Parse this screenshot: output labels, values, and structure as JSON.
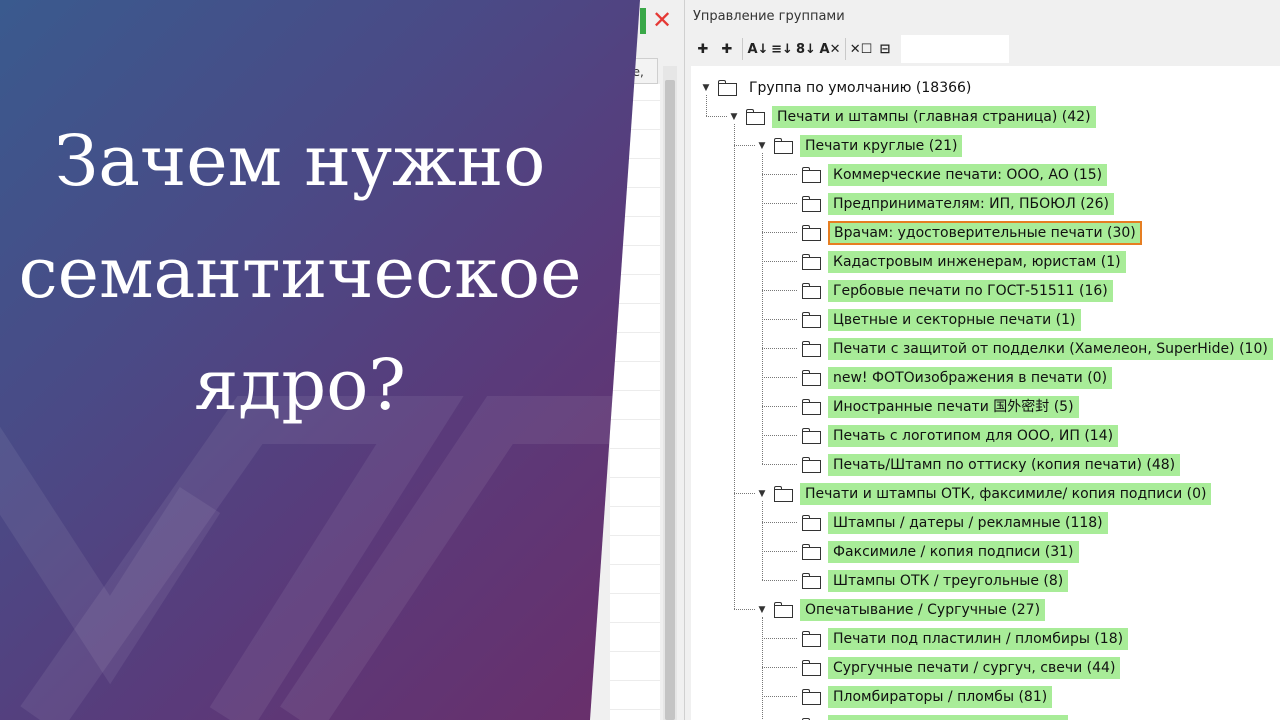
{
  "headline": [
    "Зачем нужно",
    "семантическое",
    "ядро?"
  ],
  "window": {
    "title": "Управление группами",
    "search_value": ""
  },
  "left_pane": {
    "header_fragment": "ре,"
  },
  "toolbar": [
    {
      "name": "add-group-icon",
      "glyph": "✚"
    },
    {
      "name": "add-subgroup-icon",
      "glyph": "✚"
    },
    {
      "name": "sort-az-icon",
      "glyph": "A↓"
    },
    {
      "name": "sort-color-icon",
      "glyph": "≡↓"
    },
    {
      "name": "sort-num-icon",
      "glyph": "8↓"
    },
    {
      "name": "clear-sort-icon",
      "glyph": "A✕"
    },
    {
      "name": "mark-icon",
      "glyph": "✕☐"
    },
    {
      "name": "tree-icon",
      "glyph": "⊟"
    }
  ],
  "tree": [
    {
      "label": "Группа по умолчанию (18366)",
      "level": 0,
      "expanded": true,
      "highlight": false
    },
    {
      "label": "Печати и штампы (главная страница) (42)",
      "level": 1,
      "expanded": true,
      "highlight": true
    },
    {
      "label": "Печати круглые (21)",
      "level": 2,
      "expanded": true,
      "highlight": true
    },
    {
      "label": "Коммерческие печати: ООО, АО (15)",
      "level": 3,
      "highlight": true
    },
    {
      "label": "Предпринимателям: ИП, ПБОЮЛ (26)",
      "level": 3,
      "highlight": true
    },
    {
      "label": "Врачам: удостоверительные печати (30)",
      "level": 3,
      "highlight": true,
      "selected": true
    },
    {
      "label": "Кадастровым инженерам, юристам (1)",
      "level": 3,
      "highlight": true
    },
    {
      "label": "Гербовые печати по ГОСТ-51511 (16)",
      "level": 3,
      "highlight": true
    },
    {
      "label": "Цветные и секторные печати (1)",
      "level": 3,
      "highlight": true
    },
    {
      "label": "Печати с защитой от подделки (Хамелеон, SuperHide) (10)",
      "level": 3,
      "highlight": true
    },
    {
      "label": "new! ФОТОизображения в печати (0)",
      "level": 3,
      "highlight": true
    },
    {
      "label": "Иностранные печати 国外密封 (5)",
      "level": 3,
      "highlight": true
    },
    {
      "label": "Печать с логотипом для ООО, ИП (14)",
      "level": 3,
      "highlight": true
    },
    {
      "label": "Печать/Штамп по оттиску (копия печати) (48)",
      "level": 3,
      "highlight": true
    },
    {
      "label": "Печати и штампы ОТК, факсимиле/ копия подписи (0)",
      "level": 2,
      "expanded": true,
      "highlight": true
    },
    {
      "label": "Штампы / датеры / рекламные (118)",
      "level": 3,
      "highlight": true
    },
    {
      "label": "Факсимиле / копия подписи (31)",
      "level": 3,
      "highlight": true
    },
    {
      "label": "Штампы ОТК / треугольные (8)",
      "level": 3,
      "highlight": true
    },
    {
      "label": "Опечатывание / Сургучные (27)",
      "level": 2,
      "expanded": true,
      "highlight": true
    },
    {
      "label": "Печати под пластилин / пломбиры (18)",
      "level": 3,
      "highlight": true
    },
    {
      "label": "Сургучные печати / сургуч, свечи (44)",
      "level": 3,
      "highlight": true
    },
    {
      "label": "Пломбираторы / пломбы (81)",
      "level": 3,
      "highlight": true
    },
    {
      "label": "",
      "level": 3,
      "highlight": true
    }
  ]
}
